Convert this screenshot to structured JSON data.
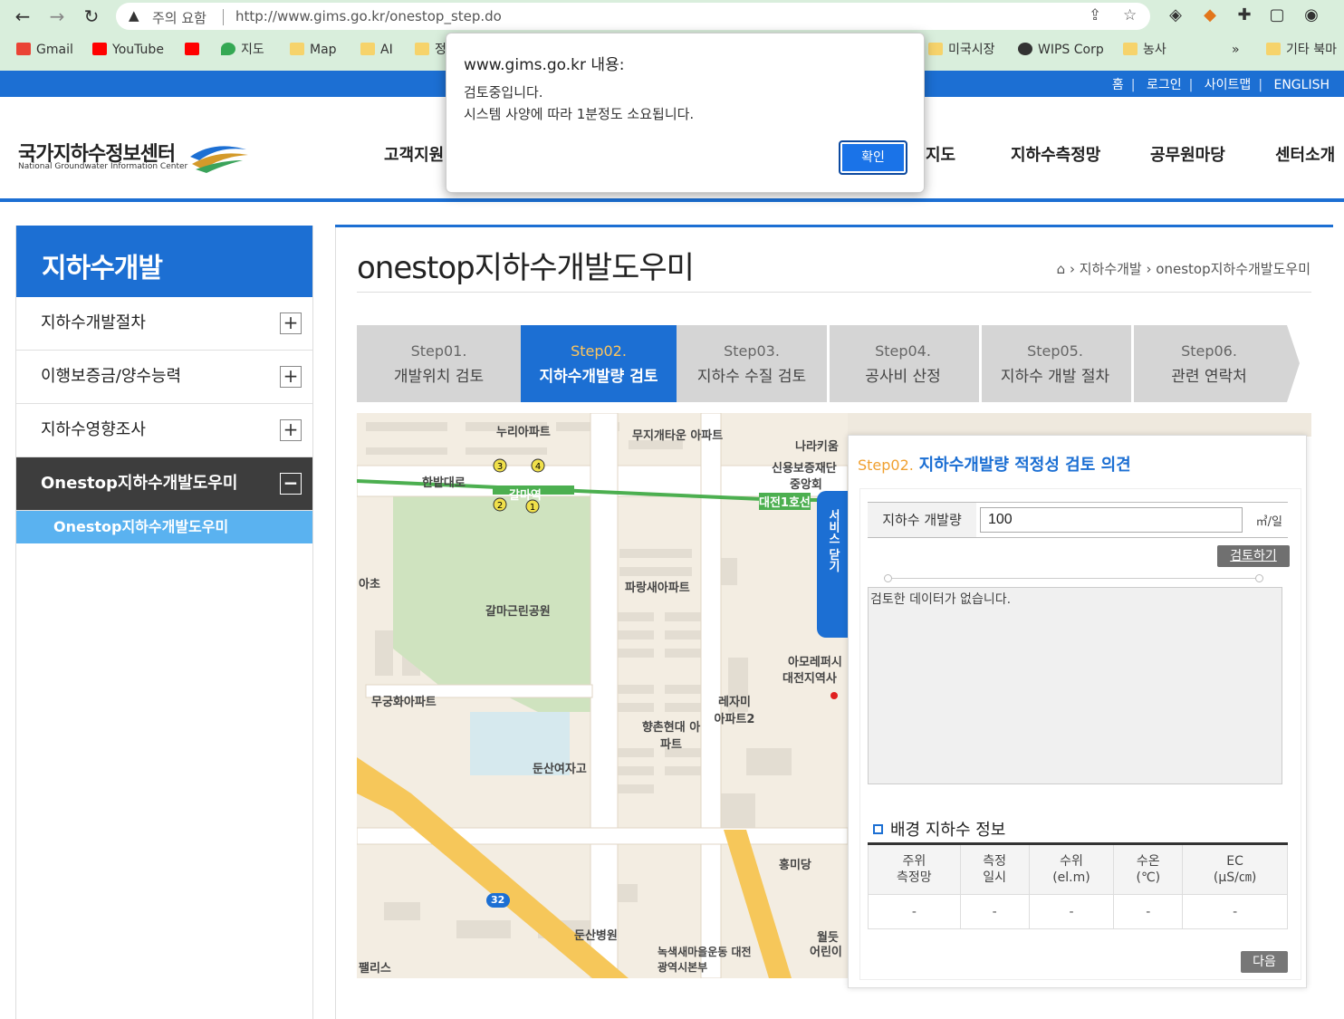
{
  "browser": {
    "security_label": "주의 요함",
    "url": "http://www.gims.go.kr/onestop_step.do",
    "bookmarks": [
      "Gmail",
      "YouTube",
      "지도",
      "Map",
      "AI",
      "정",
      "미국시장",
      "WIPS Corp",
      "농사",
      "»",
      "기타 북마"
    ]
  },
  "site": {
    "top_links": [
      "홈",
      "로그인",
      "사이트맵",
      "ENGLISH"
    ],
    "logo_ko": "국가지하수정보센터",
    "logo_en": "National Groundwater Information Center",
    "gnb": [
      "고객지원",
      "지도",
      "지하수측정망",
      "공무원마당",
      "센터소개"
    ]
  },
  "lnb": {
    "title": "지하수개발",
    "items": [
      {
        "label": "지하수개발절차",
        "toggle": "+"
      },
      {
        "label": "이행보증금/양수능력",
        "toggle": "+"
      },
      {
        "label": "지하수영향조사",
        "toggle": "+"
      },
      {
        "label": "Onestop지하수개발도우미",
        "toggle": "−"
      }
    ],
    "sub_item": "Onestop지하수개발도우미"
  },
  "content": {
    "page_title": "onestop지하수개발도우미",
    "breadcrumb": [
      "지하수개발",
      "onestop지하수개발도우미"
    ],
    "steps": [
      {
        "num": "Step01.",
        "name": "개발위치 검토"
      },
      {
        "num": "Step02.",
        "name": "지하수개발량 검토"
      },
      {
        "num": "Step03.",
        "name": "지하수 수질 검토"
      },
      {
        "num": "Step04.",
        "name": "공사비 산정"
      },
      {
        "num": "Step05.",
        "name": "지하수 개발 절차"
      },
      {
        "num": "Step06.",
        "name": "관련 연락처"
      }
    ],
    "active_step": 1
  },
  "map": {
    "labels": [
      "누리아파트",
      "무지개타운 아파트",
      "나라키움",
      "신용보증재단",
      "중앙회",
      "한밭대로",
      "갈마역",
      "대전1호선",
      "갈마근린공원",
      "파랑새아파트",
      "아모레퍼시",
      "대전지역사",
      "무궁화아파트",
      "레자미 아파트2",
      "향촌현대 아파트",
      "둔산여자고",
      "홍미당",
      "둔산병원",
      "녹색새마을운동 대전광역시본부",
      "월듯",
      "어린이",
      "팰리스",
      "아초",
      "32"
    ],
    "service_tab": "서비스 닫기"
  },
  "panel": {
    "step_prefix": "Step02.",
    "title": "지하수개발량 적정성 검토 의견",
    "field_label": "지하수 개발량",
    "field_value": "100",
    "unit": "㎥/일",
    "review_button": "검토하기",
    "result_text": "검토한 데이터가 없습니다.",
    "section_title": "배경 지하수 정보",
    "table_headers": [
      [
        "주위",
        "측정망"
      ],
      [
        "측정",
        "일시"
      ],
      [
        "수위",
        "(el.m)"
      ],
      [
        "수온",
        "(℃)"
      ],
      [
        "EC",
        "(μS/㎝)"
      ]
    ],
    "table_row": [
      "-",
      "-",
      "-",
      "-",
      "-"
    ],
    "next_button": "다음"
  },
  "dialog": {
    "title": "www.gims.go.kr 내용:",
    "message_1": "검토중입니다.",
    "message_2": "시스템 사양에 따라 1분정도 소요됩니다.",
    "ok_label": "확인"
  },
  "colors": {
    "brand_blue": "#1c6fd3",
    "dialog_button": "#1a73e8",
    "lnb_active": "#3d3d3d",
    "lnb_sub": "#5ab2f0",
    "step_highlight": "#ffc65c"
  }
}
